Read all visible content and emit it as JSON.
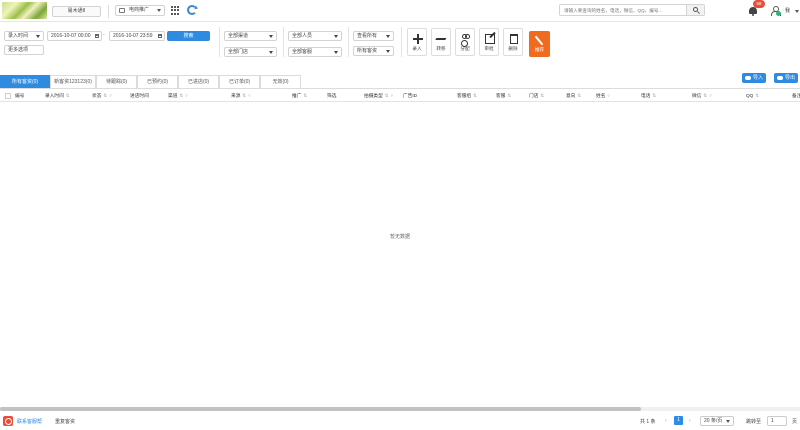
{
  "colors": {
    "primary": "#2f8be0",
    "accent": "#ef6b1f",
    "badge": "#e84e3c",
    "online": "#2bb673"
  },
  "topbar": {
    "dept_button": "易木通II",
    "project_select": "电商推广",
    "search_placeholder": "请输入要查询的姓名，电话，微信，QQ，编号...",
    "notification_count": "58",
    "user_name": "我"
  },
  "filters": {
    "time_type": "录入时间",
    "date_start": "2016-10-07 00:00",
    "date_end": "2016-10-07 23:59",
    "search_button": "搜索",
    "more_conditions": "更多选项",
    "channel_select": "全部渠道",
    "store_select": "全部门店",
    "staff_select": "全部人员",
    "service_select": "全部客服",
    "view_select": "查看所有",
    "ownership_select": "所有客资"
  },
  "toolbar": [
    {
      "label": "录入",
      "icon": "plus-icon"
    },
    {
      "label": "转移",
      "icon": "transfer-icon"
    },
    {
      "label": "分配",
      "icon": "assign-icon"
    },
    {
      "label": "审批",
      "icon": "edit-icon"
    },
    {
      "label": "删除",
      "icon": "trash-icon"
    }
  ],
  "toolbar_special": {
    "label": "推荐",
    "icon": "magic-wand-icon"
  },
  "tabs": [
    {
      "label": "所有客资(0)",
      "active": true
    },
    {
      "label": "新客资123123(0)",
      "active": false
    },
    {
      "label": "待跟踪(0)",
      "active": false
    },
    {
      "label": "已预约(0)",
      "active": false
    },
    {
      "label": "已进店(0)",
      "active": false
    },
    {
      "label": "已订单(0)",
      "active": false
    },
    {
      "label": "无效(0)",
      "active": false
    }
  ],
  "actions": {
    "import": "导入",
    "export": "导出"
  },
  "table": {
    "columns": [
      {
        "label": "编号",
        "sort": false,
        "filter": false
      },
      {
        "label": "录入时间",
        "sort": true,
        "filter": false
      },
      {
        "label": "状态",
        "sort": true,
        "filter": true
      },
      {
        "label": "进店时间",
        "sort": false,
        "filter": false
      },
      {
        "label": "渠道",
        "sort": true,
        "filter": true
      },
      {
        "label": "来源",
        "sort": true,
        "filter": true
      },
      {
        "label": "推广",
        "sort": true,
        "filter": false
      },
      {
        "label": "筛选",
        "sort": false,
        "filter": false
      },
      {
        "label": "拍摄类型",
        "sort": true,
        "filter": true
      },
      {
        "label": "广告ID",
        "sort": false,
        "filter": false
      },
      {
        "label": "客服组",
        "sort": true,
        "filter": false
      },
      {
        "label": "客服",
        "sort": true,
        "filter": false
      },
      {
        "label": "门店",
        "sort": true,
        "filter": false
      },
      {
        "label": "意向",
        "sort": true,
        "filter": false
      },
      {
        "label": "姓名",
        "sort": false,
        "filter": true
      },
      {
        "label": "电话",
        "sort": true,
        "filter": false
      },
      {
        "label": "微信",
        "sort": true,
        "filter": true
      },
      {
        "label": "QQ",
        "sort": true,
        "filter": false
      },
      {
        "label": "备注",
        "sort": false,
        "filter": false
      }
    ],
    "rows": [],
    "empty_text": "暂无数据"
  },
  "footer": {
    "contact": "联系客服帮",
    "reset": "重复客资",
    "total": "共 1 条",
    "current_page": "1",
    "page_size": "20 条/页",
    "goto_label": "跳转至",
    "goto_value": "1",
    "page_suffix": "页"
  }
}
